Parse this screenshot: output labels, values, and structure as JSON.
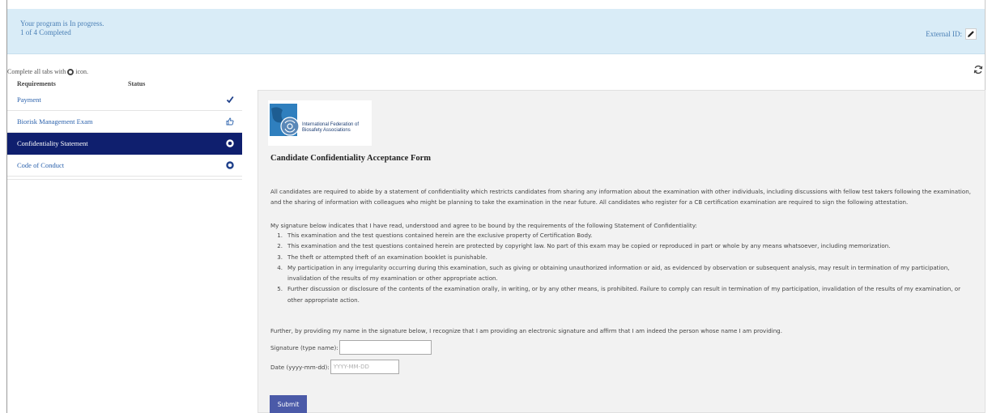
{
  "banner": {
    "status_line": "Your program is In progress.",
    "progress_line": "1 of 4 Completed",
    "external_id_label": "External ID:"
  },
  "hint": {
    "prefix": "Complete all tabs with",
    "suffix": "icon."
  },
  "sidebar": {
    "col_requirements": "Requirements",
    "col_status": "Status",
    "items": [
      {
        "label": "Payment",
        "status_icon": "checkmark-icon"
      },
      {
        "label": "Biorisk Management Exam",
        "status_icon": "thumbs-up-icon"
      },
      {
        "label": "Confidentiality Statement",
        "status_icon": "circle-icon"
      },
      {
        "label": "Code of Conduct",
        "status_icon": "circle-icon"
      }
    ]
  },
  "content": {
    "logo_text_line1": "International Federation of",
    "logo_text_line2": "Biosafety Associations",
    "form_title": "Candidate Confidentiality Acceptance Form",
    "para1": "All candidates are required to abide by a statement of confidentiality which restricts candidates from sharing any information about the examination with other individuals, including discussions with fellow test takers following the examination, and the sharing of information with colleagues who might be planning to take the examination in the near future. All candidates who register for a CB certification examination are required to sign the following attestation.",
    "para2": "My signature below indicates that I have read, understood and agree to be bound by the requirements of the following Statement of Confidentiality:",
    "list": [
      "This examination and the test questions contained herein are the exclusive property of Certification Body.",
      "This examination and the test questions contained herein are protected by copyright law. No part of this exam may be copied or reproduced in part or whole by any means whatsoever, including memorization.",
      "The theft or attempted theft of an examination booklet is punishable.",
      "My participation in any irregularity occurring during this examination, such as giving or obtaining unauthorized information or aid, as evidenced by observation or subsequent analysis, may result in termination of my participation, invalidation of the results of my examination or other appropriate action.",
      "Further discussion or disclosure of the contents of the examination orally, in writing, or by any other means, is prohibited. Failure to comply can result in termination of my participation, invalidation of the results of my examination, or other appropriate action."
    ],
    "para3": "Further, by providing my name in the signature below, I recognize that I am providing an electronic signature and affirm that I am indeed the person whose name I am providing.",
    "signature_label": "Signature (type name):",
    "signature_value": "",
    "date_label": "Date (yyyy-mm-dd):",
    "date_placeholder": "YYYY-MM-DD",
    "submit_label": "Submit"
  },
  "colors": {
    "banner_bg": "#d9ecf7",
    "link": "#2d63ad",
    "active_nav": "#0f1f6e",
    "submit": "#4b5aa8"
  }
}
